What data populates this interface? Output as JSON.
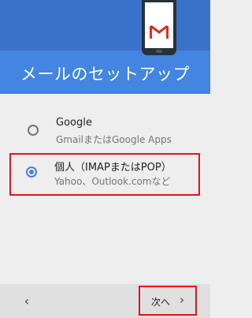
{
  "header": {
    "title": "メールのセットアップ",
    "illustration_icon": "gmail-phone-icon",
    "colors": {
      "band_top": "#3b72c9",
      "band_bottom": "#4385e0"
    }
  },
  "options": [
    {
      "title": "Google",
      "subtitle": "GmailまたはGoogle Apps",
      "selected": false
    },
    {
      "title": "個人（IMAPまたはPOP）",
      "subtitle": "Yahoo、Outlook.comなど",
      "selected": true
    }
  ],
  "footer": {
    "back_icon": "‹",
    "next_label": "次へ",
    "next_icon": "›"
  },
  "accent_color": "#4a7fdc",
  "highlight_color": "#e0141d"
}
